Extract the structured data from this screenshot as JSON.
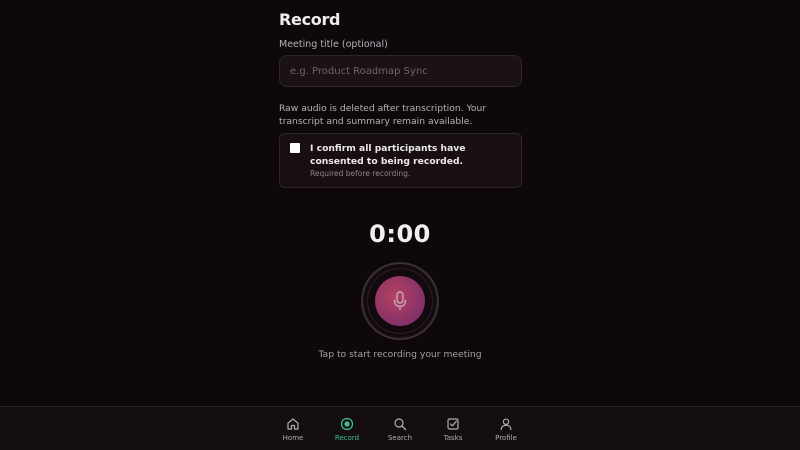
{
  "page": {
    "title": "Record"
  },
  "meeting_title": {
    "label": "Meeting title (optional)",
    "placeholder": "e.g. Product Roadmap Sync",
    "value": ""
  },
  "notice": "Raw audio is deleted after transcription. Your transcript and summary remain available.",
  "consent": {
    "label": "I confirm all participants have consented to being recorded.",
    "sublabel": "Required before recording.",
    "checked": false
  },
  "recorder": {
    "timer": "0:00",
    "hint": "Tap to start recording your meeting",
    "button_icon": "microphone-icon"
  },
  "nav": {
    "items": [
      {
        "label": "Home",
        "icon": "home-icon",
        "active": false
      },
      {
        "label": "Record",
        "icon": "record-icon",
        "active": true
      },
      {
        "label": "Search",
        "icon": "search-icon",
        "active": false
      },
      {
        "label": "Tasks",
        "icon": "tasks-icon",
        "active": false
      },
      {
        "label": "Profile",
        "icon": "profile-icon",
        "active": false
      }
    ]
  },
  "colors": {
    "background": "#0e080c",
    "accent_active": "#3fc28e",
    "record_button": "#a23b62"
  }
}
